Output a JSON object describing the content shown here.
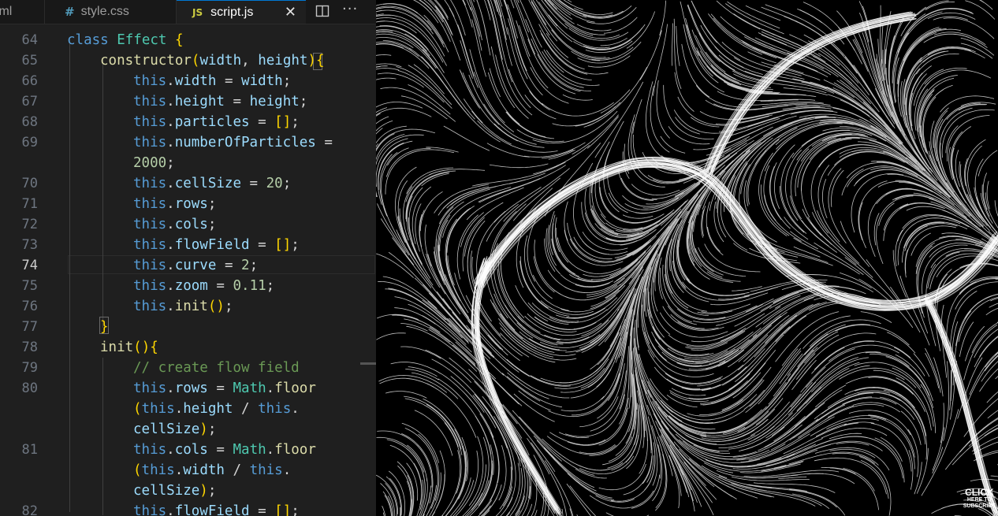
{
  "tabs": [
    {
      "label": "tml",
      "icon": "file-icon"
    },
    {
      "label": "style.css",
      "icon": "hash-icon"
    },
    {
      "label": "script.js",
      "icon": "js-icon",
      "icon_text": "JS",
      "active": true
    }
  ],
  "tab_close_glyph": "✕",
  "more_glyph": "···",
  "code": {
    "current_line": "74",
    "lines": [
      {
        "n": "64",
        "text": "class Effect {"
      },
      {
        "n": "65",
        "text": "constructor(width, height){"
      },
      {
        "n": "66",
        "text": "this.width = width;"
      },
      {
        "n": "67",
        "text": "this.height = height;"
      },
      {
        "n": "68",
        "text": "this.particles = [];"
      },
      {
        "n": "69",
        "text": "this.numberOfParticles ="
      },
      {
        "n": "",
        "text": "2000;"
      },
      {
        "n": "70",
        "text": "this.cellSize = 20;"
      },
      {
        "n": "71",
        "text": "this.rows;"
      },
      {
        "n": "72",
        "text": "this.cols;"
      },
      {
        "n": "73",
        "text": "this.flowField = [];"
      },
      {
        "n": "74",
        "text": "this.curve = 2;"
      },
      {
        "n": "75",
        "text": "this.zoom = 0.11;"
      },
      {
        "n": "76",
        "text": "this.init();"
      },
      {
        "n": "77",
        "text": "}"
      },
      {
        "n": "78",
        "text": "init(){"
      },
      {
        "n": "79",
        "text": "// create flow field"
      },
      {
        "n": "80",
        "text": "this.rows = Math.floor"
      },
      {
        "n": "",
        "text": "(this.height / this."
      },
      {
        "n": "",
        "text": "cellSize);"
      },
      {
        "n": "81",
        "text": "this.cols = Math.floor"
      },
      {
        "n": "",
        "text": "(this.width / this."
      },
      {
        "n": "",
        "text": "cellSize);"
      },
      {
        "n": "82",
        "text": "this.flowField = [];"
      }
    ]
  },
  "canvas": {
    "background": "#000000",
    "stroke_color": "#ffffff",
    "description_icon": "flow-field-canvas"
  },
  "watermark": {
    "line1": "CLICK",
    "line2": "HERE TO",
    "line3": "SUBSCRIBE"
  },
  "colors": {
    "editor_bg": "#1f1f1f",
    "keyword": "#569cd6",
    "property": "#9cdcfe",
    "number": "#b5cea8",
    "comment": "#6a9955",
    "function": "#dcdcaa",
    "class": "#4ec9b0"
  }
}
